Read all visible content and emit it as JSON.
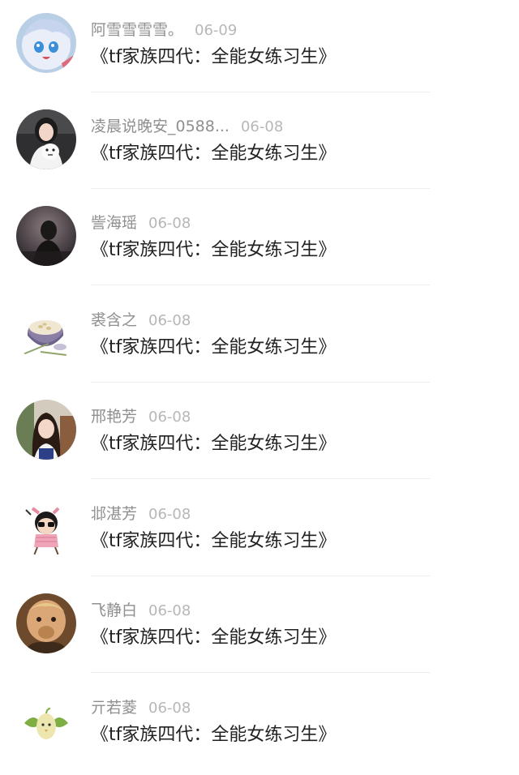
{
  "comments": [
    {
      "name": "阿雪雪雪雪。",
      "date": "06-09",
      "text": "《tf家族四代：全能女练习生》",
      "avatar": "anime-girl-avatar"
    },
    {
      "name": "凌晨说晚安_0588...",
      "date": "06-08",
      "text": "《tf家族四代：全能女练习生》",
      "avatar": "girl-with-plush-avatar"
    },
    {
      "name": "訾海瑶",
      "date": "06-08",
      "text": "《tf家族四代：全能女练习生》",
      "avatar": "dark-silhouette-avatar"
    },
    {
      "name": "裘含之",
      "date": "06-08",
      "text": "《tf家族四代：全能女练习生》",
      "avatar": "soup-bowl-avatar"
    },
    {
      "name": "邢艳芳",
      "date": "06-08",
      "text": "《tf家族四代：全能女练习生》",
      "avatar": "long-hair-girl-avatar"
    },
    {
      "name": "邶湛芳",
      "date": "06-08",
      "text": "《tf家族四代：全能女练习生》",
      "avatar": "cartoon-girl-sunglasses-avatar"
    },
    {
      "name": "飞静白",
      "date": "06-08",
      "text": "《tf家族四代：全能女练习生》",
      "avatar": "child-face-avatar"
    },
    {
      "name": "亓若菱",
      "date": "06-08",
      "text": "《tf家族四代：全能女练习生》",
      "avatar": "green-bird-avatar"
    }
  ]
}
